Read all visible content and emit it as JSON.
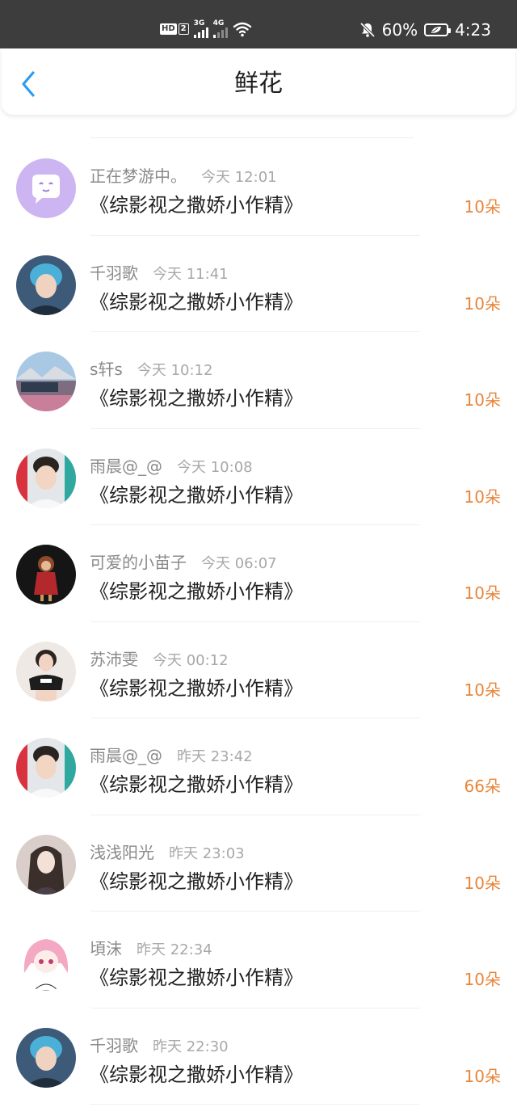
{
  "status_bar": {
    "hd": "HD",
    "sim": "2",
    "net1": "3G",
    "net2": "4G",
    "battery": "60%",
    "time": "4:23"
  },
  "header": {
    "title": "鲜花"
  },
  "items": [
    {
      "user": "正在梦游中。",
      "time": "今天 12:01",
      "book": "《综影视之撒娇小作精》",
      "count": "10朵",
      "avatar": "chat-bubble"
    },
    {
      "user": "千羽歌",
      "time": "今天 11:41",
      "book": "《综影视之撒娇小作精》",
      "count": "10朵",
      "avatar": "photo"
    },
    {
      "user": "s轩s",
      "time": "今天 10:12",
      "book": "《综影视之撒娇小作精》",
      "count": "10朵",
      "avatar": "photo"
    },
    {
      "user": "雨晨@_@",
      "time": "今天 10:08",
      "book": "《综影视之撒娇小作精》",
      "count": "10朵",
      "avatar": "photo"
    },
    {
      "user": "可爱的小苗子",
      "time": "今天 06:07",
      "book": "《综影视之撒娇小作精》",
      "count": "10朵",
      "avatar": "photo"
    },
    {
      "user": "苏沛雯",
      "time": "今天 00:12",
      "book": "《综影视之撒娇小作精》",
      "count": "10朵",
      "avatar": "photo"
    },
    {
      "user": "雨晨@_@",
      "time": "昨天 23:42",
      "book": "《综影视之撒娇小作精》",
      "count": "66朵",
      "avatar": "photo"
    },
    {
      "user": "浅浅阳光",
      "time": "昨天 23:03",
      "book": "《综影视之撒娇小作精》",
      "count": "10朵",
      "avatar": "photo"
    },
    {
      "user": "頃沫",
      "time": "昨天 22:34",
      "book": "《综影视之撒娇小作精》",
      "count": "10朵",
      "avatar": "photo"
    },
    {
      "user": "千羽歌",
      "time": "昨天 22:30",
      "book": "《综影视之撒娇小作精》",
      "count": "10朵",
      "avatar": "photo"
    }
  ],
  "colors": {
    "status_bar_bg": "#3d3d3d",
    "accent_blue": "#2d9cf0",
    "count_orange": "#e8863b",
    "username_gray": "#8a8a8a"
  }
}
